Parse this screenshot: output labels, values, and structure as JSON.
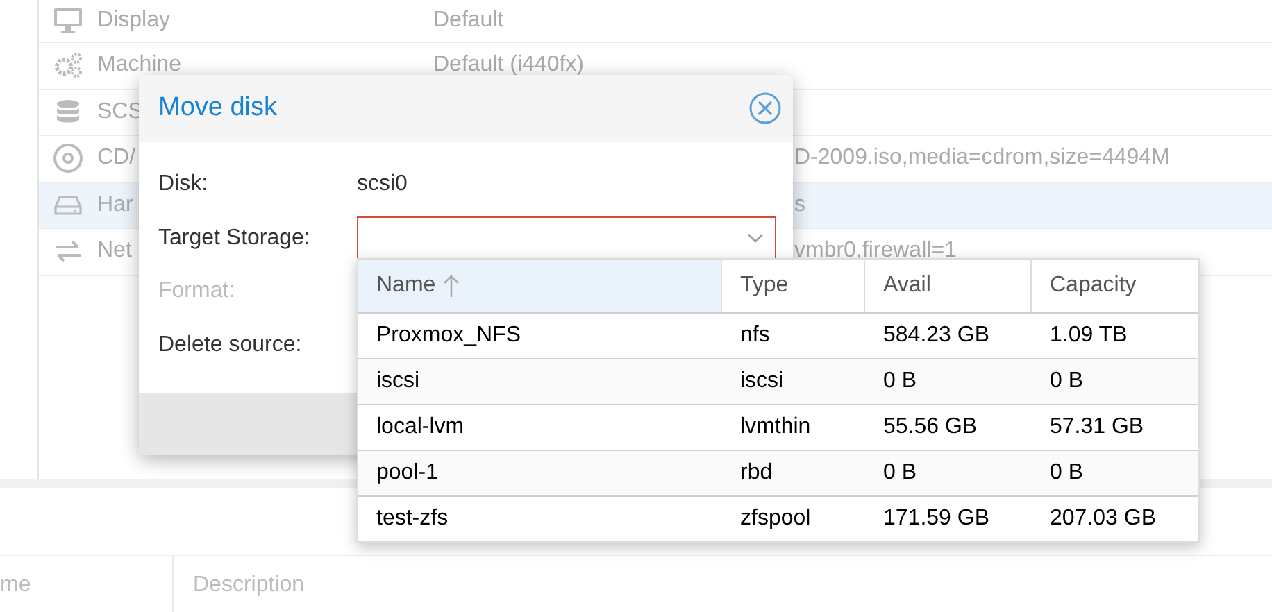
{
  "hardware": {
    "rows": [
      {
        "kind": "monitor",
        "name": "Display",
        "value": "Default",
        "selected": false
      },
      {
        "kind": "gears",
        "name": "Machine",
        "value": "Default (i440fx)",
        "selected": false
      },
      {
        "kind": "database",
        "name": "SCS",
        "selected": false
      },
      {
        "kind": "disc",
        "name": "CD/",
        "value": "D-2009.iso,media=cdrom,size=4494M",
        "selected": false
      },
      {
        "kind": "drive",
        "name": "Har",
        "value": "s",
        "selected": true
      },
      {
        "kind": "arrows",
        "name": "Net",
        "value": "vmbr0,firewall=1",
        "selected": false
      }
    ]
  },
  "bottom_grid": {
    "columns": [
      "me",
      "Description"
    ]
  },
  "dialog": {
    "title": "Move disk",
    "fields": [
      {
        "kind": "text",
        "label": "Disk:",
        "value": "scsi0",
        "disabled": false
      },
      {
        "kind": "combo",
        "label": "Target Storage:",
        "disabled": false,
        "invalid": true
      },
      {
        "kind": "label",
        "label": "Format:",
        "disabled": true
      },
      {
        "kind": "label",
        "label": "Delete source:",
        "disabled": false
      }
    ]
  },
  "dropdown": {
    "columns": [
      {
        "label": "Name",
        "sorted": true
      },
      {
        "label": "Type",
        "sorted": false
      },
      {
        "label": "Avail",
        "sorted": false
      },
      {
        "label": "Capacity",
        "sorted": false
      }
    ],
    "rows": [
      [
        "Proxmox_NFS",
        "nfs",
        "584.23 GB",
        "1.09 TB"
      ],
      [
        "iscsi",
        "iscsi",
        "0 B",
        "0 B"
      ],
      [
        "local-lvm",
        "lvmthin",
        "55.56 GB",
        "57.31 GB"
      ],
      [
        "pool-1",
        "rbd",
        "0 B",
        "0 B"
      ],
      [
        "test-zfs",
        "zfspool",
        "171.59 GB",
        "207.03 GB"
      ]
    ]
  }
}
